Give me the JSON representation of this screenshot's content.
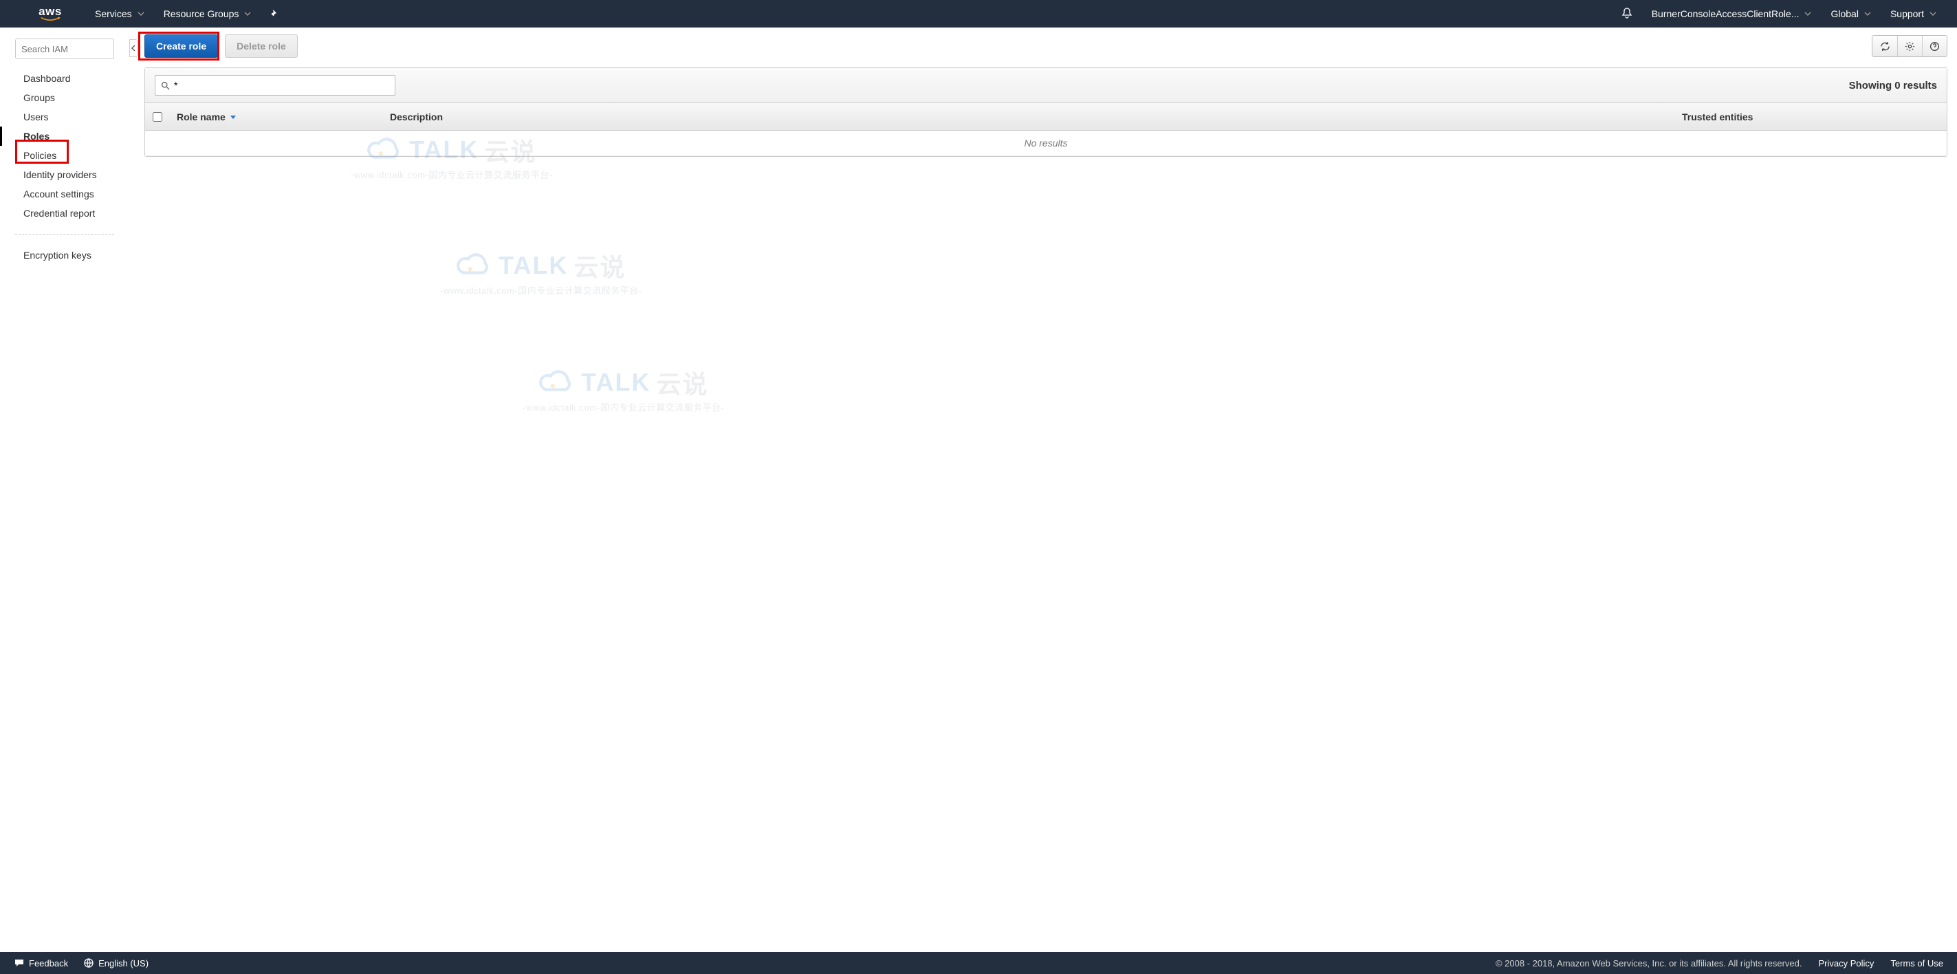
{
  "header": {
    "services": "Services",
    "resource_groups": "Resource Groups",
    "account": "BurnerConsoleAccessClientRole...",
    "region": "Global",
    "support": "Support"
  },
  "sidebar": {
    "search_placeholder": "Search IAM",
    "items": [
      "Dashboard",
      "Groups",
      "Users",
      "Roles",
      "Policies",
      "Identity providers",
      "Account settings",
      "Credential report"
    ],
    "secondary": [
      "Encryption keys"
    ]
  },
  "actions": {
    "create": "Create role",
    "delete": "Delete role"
  },
  "filter": {
    "value": "*",
    "results_text": "Showing 0 results"
  },
  "columns": {
    "name": "Role name",
    "desc": "Description",
    "trust": "Trusted entities"
  },
  "table": {
    "empty": "No results"
  },
  "watermark": {
    "brand": "TALK",
    "brand_cn": "云说",
    "sub": "-www.idctalk.com-国内专业云计算交流服务平台-"
  },
  "footer": {
    "feedback": "Feedback",
    "language": "English (US)",
    "copyright": "© 2008 - 2018, Amazon Web Services, Inc. or its affiliates. All rights reserved.",
    "privacy": "Privacy Policy",
    "terms": "Terms of Use"
  }
}
